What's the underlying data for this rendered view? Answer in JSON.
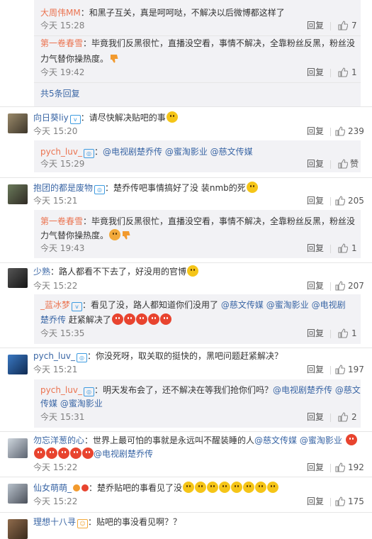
{
  "labels": {
    "reply": "回复",
    "zan": "赞"
  },
  "colors": {
    "name": "#eb7350",
    "link": "#3a66a5",
    "reply_bg": "#f2f2f5",
    "time": "#808080"
  },
  "top_replies": [
    {
      "name": "大周伟MM",
      "sep": "：",
      "text": "和黑子互关，真是呵呵哒，不解决以后微博都这样了",
      "time": "今天 15:28",
      "likes": "7"
    },
    {
      "name": "第一卷春雪",
      "sep": "：",
      "text": "毕竟我们反黑很忙，直播没空看，事情不解决，全靠粉丝反黑，粉丝没",
      "text2": "力气替你操热度。",
      "time": "今天 19:42",
      "likes": "1"
    }
  ],
  "more_replies": "共5条回复",
  "comments": [
    {
      "name": "向日葵liy",
      "sep": "：",
      "text": "请尽快解决贴吧的事",
      "time": "今天 15:20",
      "likes": "239"
    },
    {
      "name": "抱团的都是废物",
      "sep": "：",
      "text": "楚乔传吧事情搞好了没 装nmb的死",
      "time": "今天 15:21",
      "likes": "205"
    },
    {
      "name": "少熟",
      "sep": "：",
      "text": "路人都看不下去了，好没用的官博",
      "time": "今天 15:22",
      "likes": "207"
    },
    {
      "name": "pych_luv_",
      "sep": "：",
      "text": "你没死呀，取关取的挺快的，黑吧问题赶紧解决？",
      "time": "今天 15:21",
      "likes": "197"
    },
    {
      "name": "勿忘洋葱的心",
      "sep": "：",
      "text": "世界上最可怕的事就是永远叫不醒装睡的人",
      "mention1": "@慈文传媒",
      "mention2": "@蜜淘影业",
      "mention3": "@电视剧楚乔传",
      "time": "今天 15:22",
      "likes": "192"
    },
    {
      "name": "仙女萌萌_",
      "sep": "：",
      "text": "楚乔贴吧的事看见了没",
      "time": "今天 15:22",
      "likes": "175"
    },
    {
      "name": "理想十八寻",
      "sep": "：",
      "text": "贴吧的事没看见啊？？"
    }
  ],
  "replies": [
    {
      "name": "pych_luv_",
      "sep": "：",
      "m1": "@电视剧楚乔传",
      "m2": "@蜜淘影业",
      "m3": "@慈文传媒",
      "time": "今天 15:29",
      "likes": "赞"
    },
    {
      "name": "第一卷春雪",
      "sep": "：",
      "text": "毕竟我们反黑很忙，直播没空看，事情不解决，全靠粉丝反黑，粉丝没",
      "text2": "力气替你操热度。",
      "time": "今天 19:43",
      "likes": "1"
    },
    {
      "name": "_蓝冰梦",
      "sep": "：",
      "text": "看见了没，路人都知道你们没用了",
      "m1": "@慈文传媒",
      "m2": "@蜜淘影业",
      "m3": "@电视剧",
      "text2": "楚乔传",
      "text3": "赶紧解决了",
      "time": "今天 15:35",
      "likes": "1"
    },
    {
      "name": "pych_luv_",
      "sep": "：",
      "text": "明天发布会了，还不解决在等我们抢你们吗？",
      "m1": "@电视剧楚乔传",
      "m2": "@慈文",
      "text2": "传媒",
      "m3": "@蜜淘影业",
      "time": "今天 15:31",
      "likes": "2"
    }
  ]
}
